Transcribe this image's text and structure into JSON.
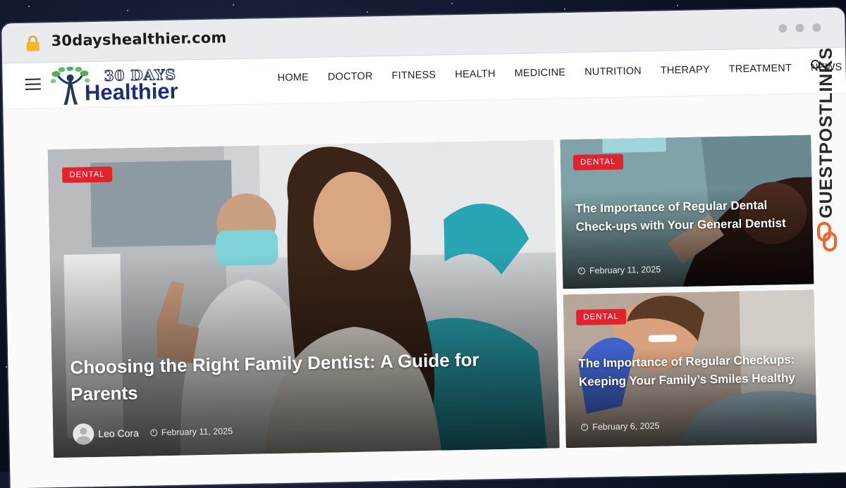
{
  "browser": {
    "url": "30dayshealthier.com",
    "lock_icon": "lock-icon"
  },
  "site": {
    "logo_top": "30 DAYS",
    "logo_main": "Healthier"
  },
  "nav": {
    "items": [
      "HOME",
      "DOCTOR",
      "FITNESS",
      "HEALTH",
      "MEDICINE",
      "NUTRITION",
      "THERAPY",
      "TREATMENT",
      "NEWS"
    ]
  },
  "posts": {
    "featured": {
      "category": "DENTAL",
      "title": "Choosing the Right Family Dentist: A Guide for Parents",
      "author": "Leo Cora",
      "date": "February 11, 2025"
    },
    "side1": {
      "category": "DENTAL",
      "title": "The Importance of Regular Dental Check-ups with Your General Dentist",
      "date": "February 11, 2025"
    },
    "side2": {
      "category": "DENTAL",
      "title": "The Importance of Regular Checkups: Keeping Your Family’s Smiles Healthy",
      "date": "February 6, 2025"
    }
  },
  "watermark": {
    "text": "GUESTPOSTLINKS"
  },
  "colors": {
    "badge": "#e2232e",
    "logo_blue": "#1e2f7a",
    "watermark_orange": "#f0642d"
  }
}
